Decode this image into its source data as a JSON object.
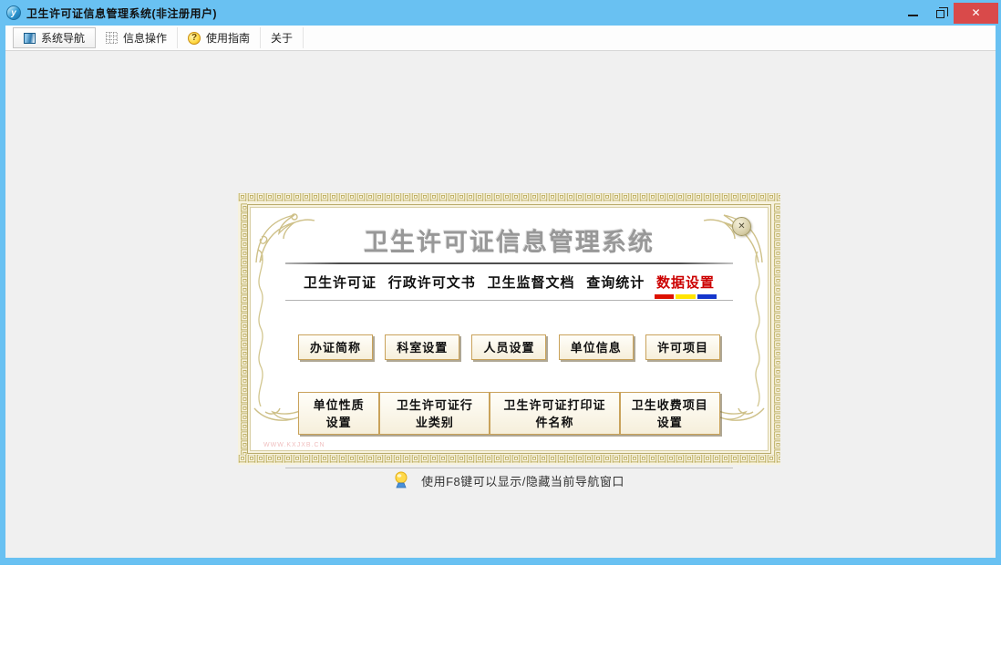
{
  "window": {
    "title": "卫生许可证信息管理系统(非注册用户)"
  },
  "icons": {
    "app": "y",
    "help_coin": "?",
    "close": "✕",
    "dialog_close": "✕"
  },
  "toolbar": {
    "items": [
      {
        "label": "系统导航",
        "icon": "navigation-icon"
      },
      {
        "label": "信息操作",
        "icon": "grid-icon"
      },
      {
        "label": "使用指南",
        "icon": "help-coin-icon"
      },
      {
        "label": "关于"
      }
    ]
  },
  "dialog": {
    "title": "卫生许可证信息管理系统",
    "menu": [
      {
        "label": "卫生许可证"
      },
      {
        "label": "行政许可文书"
      },
      {
        "label": "卫生监督文档"
      },
      {
        "label": "查询统计"
      },
      {
        "label": "数据设置",
        "active": true
      }
    ],
    "buttons_row1": [
      "办证简称",
      "科室设置",
      "人员设置",
      "单位信息",
      "许可项目"
    ],
    "buttons_row2": [
      "单位性质设置",
      "卫生许可证行业类别",
      "卫生许可证打印证件名称",
      "卫生收费项目设置"
    ],
    "footer_hint": "使用F8键可以显示/隐藏当前导航窗口",
    "watermark": "WWW.KXJXB.CN"
  },
  "colors": {
    "titlebar_blue": "#69c1f2",
    "close_red": "#d94a4a",
    "accent_red": "#cc0000",
    "gold_border": "#b3a24c",
    "tab_underline_red": "#dd1100",
    "tab_underline_yellow": "#ffe400",
    "tab_underline_blue": "#1536cc"
  }
}
